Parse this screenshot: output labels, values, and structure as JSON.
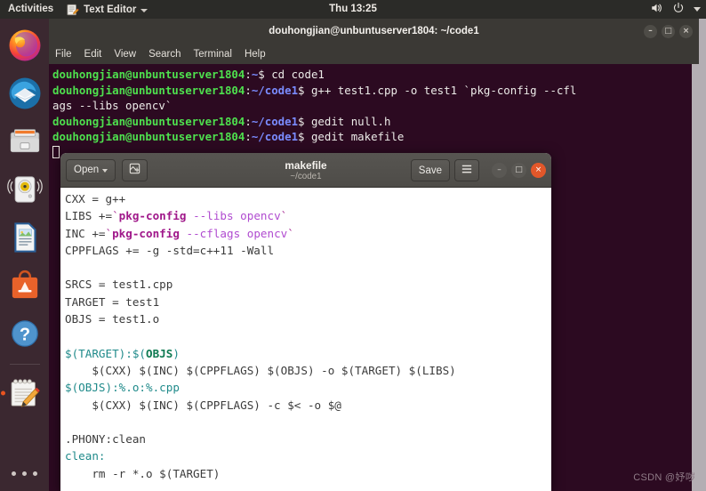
{
  "topbar": {
    "activities": "Activities",
    "app_menu": "Text Editor",
    "app_icon": "text-editor-icon",
    "clock": "Thu 13:25",
    "tray": [
      {
        "name": "volume-icon",
        "label": "Volume"
      },
      {
        "name": "power-icon",
        "label": "Power"
      },
      {
        "name": "chevron-down-icon",
        "label": "System menu"
      }
    ]
  },
  "dock": {
    "items": [
      {
        "name": "dock-item-firefox",
        "label": "Firefox",
        "running": false
      },
      {
        "name": "dock-item-thunderbird",
        "label": "Thunderbird Mail",
        "running": false
      },
      {
        "name": "dock-item-files",
        "label": "Files",
        "running": false
      },
      {
        "name": "dock-item-rhythmbox",
        "label": "Rhythmbox",
        "running": false
      },
      {
        "name": "dock-item-libreoffice-writer",
        "label": "LibreOffice Writer",
        "running": false
      },
      {
        "name": "dock-item-ubuntu-software",
        "label": "Ubuntu Software",
        "running": false
      },
      {
        "name": "dock-item-help",
        "label": "Help",
        "running": false
      },
      {
        "name": "dock-item-text-editor",
        "label": "Text Editor",
        "running": true
      }
    ],
    "show_applications": "Show Applications"
  },
  "terminal": {
    "title": "douhongjian@unbuntuserver1804: ~/code1",
    "window_buttons": [
      {
        "name": "minimize-button",
        "glyph": "–"
      },
      {
        "name": "maximize-button",
        "glyph": "□"
      },
      {
        "name": "close-button",
        "glyph": "×"
      }
    ],
    "menu": [
      "File",
      "Edit",
      "View",
      "Search",
      "Terminal",
      "Help"
    ],
    "lines": [
      {
        "segments": [
          {
            "cls": "t-user",
            "text": "douhongjian@unbuntuserver1804"
          },
          {
            "cls": "t-plain",
            "text": ":"
          },
          {
            "cls": "t-path",
            "text": "~"
          },
          {
            "cls": "t-plain",
            "text": "$ cd code1"
          }
        ]
      },
      {
        "segments": [
          {
            "cls": "t-user",
            "text": "douhongjian@unbuntuserver1804"
          },
          {
            "cls": "t-plain",
            "text": ":"
          },
          {
            "cls": "t-path",
            "text": "~/code1"
          },
          {
            "cls": "t-plain",
            "text": "$ g++ test1.cpp -o test1 `pkg-config --cfl"
          }
        ]
      },
      {
        "segments": [
          {
            "cls": "t-plain",
            "text": "ags --libs opencv`"
          }
        ]
      },
      {
        "segments": [
          {
            "cls": "t-user",
            "text": "douhongjian@unbuntuserver1804"
          },
          {
            "cls": "t-plain",
            "text": ":"
          },
          {
            "cls": "t-path",
            "text": "~/code1"
          },
          {
            "cls": "t-plain",
            "text": "$ gedit null.h"
          }
        ]
      },
      {
        "segments": [
          {
            "cls": "t-user",
            "text": "douhongjian@unbuntuserver1804"
          },
          {
            "cls": "t-plain",
            "text": ":"
          },
          {
            "cls": "t-path",
            "text": "~/code1"
          },
          {
            "cls": "t-plain",
            "text": "$ gedit makefile"
          }
        ]
      }
    ]
  },
  "gedit": {
    "open_label": "Open",
    "save_label": "Save",
    "new_tab_icon": "new-document-icon",
    "hamburger_icon": "hamburger-menu-icon",
    "title": "makefile",
    "subtitle": "~/code1",
    "window_buttons": [
      {
        "name": "minimize-button",
        "glyph": "–"
      },
      {
        "name": "maximize-button",
        "glyph": "□"
      },
      {
        "name": "close-button",
        "glyph": "×"
      }
    ],
    "document_lines": [
      {
        "segments": [
          {
            "cls": "c-def",
            "text": "CXX = g++"
          }
        ]
      },
      {
        "segments": [
          {
            "cls": "c-def",
            "text": "LIBS +="
          },
          {
            "cls": "c-tick",
            "text": "`"
          },
          {
            "cls": "c-fn",
            "text": "pkg-config"
          },
          {
            "cls": "c-arg",
            "text": " --libs opencv"
          },
          {
            "cls": "c-tick",
            "text": "`"
          }
        ]
      },
      {
        "segments": [
          {
            "cls": "c-def",
            "text": "INC +="
          },
          {
            "cls": "c-tick",
            "text": "`"
          },
          {
            "cls": "c-fn",
            "text": "pkg-config"
          },
          {
            "cls": "c-arg",
            "text": " --cflags opencv"
          },
          {
            "cls": "c-tick",
            "text": "`"
          }
        ]
      },
      {
        "segments": [
          {
            "cls": "c-def",
            "text": "CPPFLAGS += -g -std=c++11 -Wall"
          }
        ]
      },
      {
        "segments": [
          {
            "cls": "c-def",
            "text": ""
          }
        ]
      },
      {
        "segments": [
          {
            "cls": "c-def",
            "text": "SRCS = test1.cpp"
          }
        ]
      },
      {
        "segments": [
          {
            "cls": "c-def",
            "text": "TARGET = test1"
          }
        ]
      },
      {
        "segments": [
          {
            "cls": "c-def",
            "text": "OBJS = test1.o"
          }
        ]
      },
      {
        "segments": [
          {
            "cls": "c-def",
            "text": ""
          }
        ]
      },
      {
        "segments": [
          {
            "cls": "c-rule",
            "text": "$(TARGET):$("
          },
          {
            "cls": "c-bold",
            "text": "OBJS"
          },
          {
            "cls": "c-rule",
            "text": ")"
          }
        ]
      },
      {
        "segments": [
          {
            "cls": "c-def",
            "text": "    $(CXX) $(INC) $(CPPFLAGS) $(OBJS) -o $(TARGET) $(LIBS)"
          }
        ]
      },
      {
        "segments": [
          {
            "cls": "c-rule",
            "text": "$(OBJS):%.o:%.cpp"
          }
        ]
      },
      {
        "segments": [
          {
            "cls": "c-def",
            "text": "    $(CXX) $(INC) $(CPPFLAGS) -c $< -o $@"
          }
        ]
      },
      {
        "segments": [
          {
            "cls": "c-def",
            "text": ""
          }
        ]
      },
      {
        "segments": [
          {
            "cls": "c-def",
            "text": ".PHONY:clean"
          }
        ]
      },
      {
        "segments": [
          {
            "cls": "c-rule",
            "text": "clean:"
          }
        ]
      },
      {
        "segments": [
          {
            "cls": "c-def",
            "text": "    rm -r *.o $(TARGET)"
          }
        ]
      }
    ]
  },
  "watermark": "CSDN @妤哕",
  "colors": {
    "terminal_background": "#2c0a21",
    "terminal_prompt_user": "#4ee04e",
    "terminal_prompt_path": "#7a8cff",
    "topbar_background": "#2b2b28",
    "dock_background": "#3b2830",
    "accent_orange": "#e95420",
    "gedit_header": "#4e4c48",
    "makefile_rule": "#1f8a8a",
    "makefile_function": "#a0188a",
    "makefile_arg": "#b04bd0"
  }
}
